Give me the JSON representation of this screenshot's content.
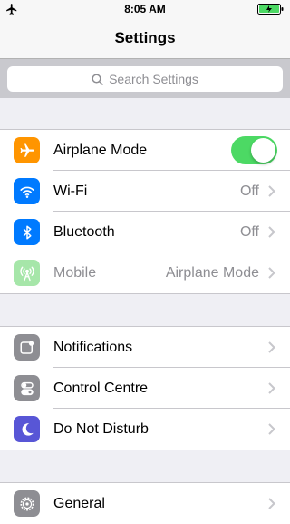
{
  "status": {
    "time": "8:05 AM"
  },
  "nav": {
    "title": "Settings"
  },
  "search": {
    "placeholder": "Search Settings"
  },
  "groups": [
    [
      {
        "label": "Airplane Mode",
        "icon": "airplane-icon",
        "color": "#ff9500",
        "toggle": true
      },
      {
        "label": "Wi-Fi",
        "value": "Off",
        "icon": "wifi-icon",
        "color": "#007aff"
      },
      {
        "label": "Bluetooth",
        "value": "Off",
        "icon": "bluetooth-icon",
        "color": "#007aff"
      },
      {
        "label": "Mobile",
        "value": "Airplane Mode",
        "icon": "antenna-icon",
        "color": "#a6e6a9",
        "disabled": true
      }
    ],
    [
      {
        "label": "Notifications",
        "icon": "notifications-icon",
        "color": "#8e8e93"
      },
      {
        "label": "Control Centre",
        "icon": "control-centre-icon",
        "color": "#8e8e93"
      },
      {
        "label": "Do Not Disturb",
        "icon": "moon-icon",
        "color": "#5856d6"
      }
    ],
    [
      {
        "label": "General",
        "icon": "gear-icon",
        "color": "#8e8e93"
      }
    ]
  ]
}
